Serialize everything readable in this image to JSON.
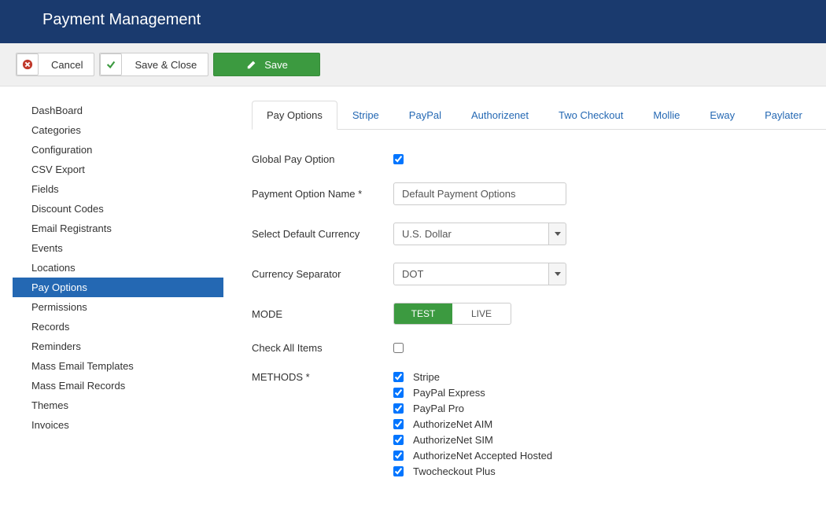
{
  "header": {
    "title": "Payment Management"
  },
  "toolbar": {
    "cancel_label": "Cancel",
    "saveclose_label": "Save & Close",
    "save_label": "Save"
  },
  "sidebar": {
    "items": [
      {
        "label": "DashBoard",
        "slug": "dashboard"
      },
      {
        "label": "Categories",
        "slug": "categories"
      },
      {
        "label": "Configuration",
        "slug": "configuration"
      },
      {
        "label": "CSV Export",
        "slug": "csv-export"
      },
      {
        "label": "Fields",
        "slug": "fields"
      },
      {
        "label": "Discount Codes",
        "slug": "discount-codes"
      },
      {
        "label": "Email Registrants",
        "slug": "email-registrants"
      },
      {
        "label": "Events",
        "slug": "events"
      },
      {
        "label": "Locations",
        "slug": "locations"
      },
      {
        "label": "Pay Options",
        "slug": "pay-options"
      },
      {
        "label": "Permissions",
        "slug": "permissions"
      },
      {
        "label": "Records",
        "slug": "records"
      },
      {
        "label": "Reminders",
        "slug": "reminders"
      },
      {
        "label": "Mass Email Templates",
        "slug": "mass-email-templates"
      },
      {
        "label": "Mass Email Records",
        "slug": "mass-email-records"
      },
      {
        "label": "Themes",
        "slug": "themes"
      },
      {
        "label": "Invoices",
        "slug": "invoices"
      }
    ],
    "active_index": 9
  },
  "tabs": {
    "items": [
      {
        "label": "Pay Options"
      },
      {
        "label": "Stripe"
      },
      {
        "label": "PayPal"
      },
      {
        "label": "Authorizenet"
      },
      {
        "label": "Two Checkout"
      },
      {
        "label": "Mollie"
      },
      {
        "label": "Eway"
      },
      {
        "label": "Paylater"
      }
    ],
    "active_index": 0
  },
  "form": {
    "global_pay_label": "Global Pay Option",
    "global_pay_checked": true,
    "name_label": "Payment Option Name *",
    "name_value": "Default Payment Options",
    "currency_label": "Select Default Currency",
    "currency_value": "U.S. Dollar",
    "separator_label": "Currency Separator",
    "separator_value": "DOT",
    "mode_label": "MODE",
    "mode_options": [
      "TEST",
      "LIVE"
    ],
    "mode_active_index": 0,
    "checkall_label": "Check All Items",
    "checkall_checked": false,
    "methods_label": "METHODS *",
    "methods": [
      {
        "label": "Stripe",
        "checked": true
      },
      {
        "label": "PayPal Express",
        "checked": true
      },
      {
        "label": "PayPal Pro",
        "checked": true
      },
      {
        "label": "AuthorizeNet AIM",
        "checked": true
      },
      {
        "label": "AuthorizeNet SIM",
        "checked": true
      },
      {
        "label": "AuthorizeNet Accepted Hosted",
        "checked": true
      },
      {
        "label": "Twocheckout Plus",
        "checked": true
      }
    ]
  }
}
